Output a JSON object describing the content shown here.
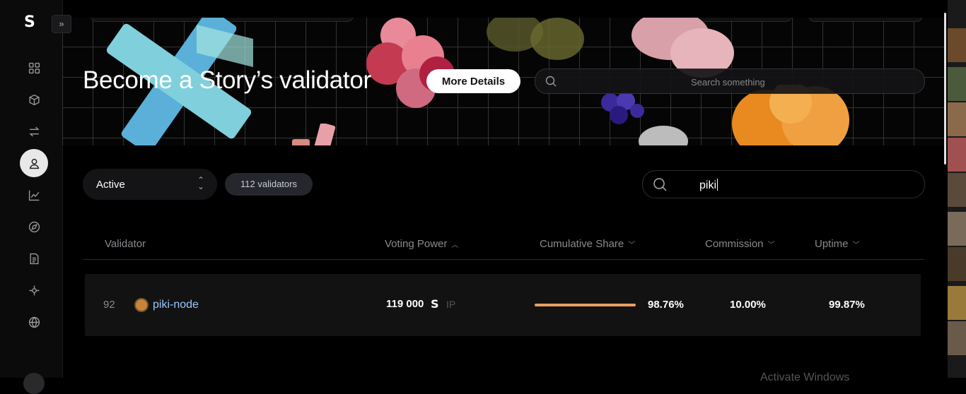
{
  "banner": {
    "title": "Become a Story’s validator",
    "more_details": "More Details",
    "search_placeholder": "Search something"
  },
  "filters": {
    "status_value": "Active",
    "validator_count": "112 validators",
    "search_value": "piki"
  },
  "table": {
    "headers": {
      "validator": "Validator",
      "voting_power": "Voting Power",
      "cumulative_share": "Cumulative Share",
      "commission": "Commission",
      "uptime": "Uptime"
    },
    "rows": [
      {
        "rank": "92",
        "name": "piki-node",
        "voting_power": "119 000",
        "unit": "IP",
        "cumulative_share": "98.76%",
        "commission": "10.00%",
        "uptime": "99.87%"
      }
    ]
  },
  "watermark": "Activate Windows",
  "icons": [
    "logo-icon",
    "expand-icon",
    "grid-icon",
    "cube-icon",
    "transfer-icon",
    "user-icon",
    "chart-icon",
    "compass-icon",
    "document-icon",
    "network-icon",
    "globe-icon",
    "search-icon",
    "chevron-up-down-icon",
    "sort-up-icon",
    "sort-down-icon"
  ],
  "colors": {
    "accent_bar": "#e8a060",
    "validator_link": "#9ac8ff",
    "badge_bg": "#25272c"
  }
}
